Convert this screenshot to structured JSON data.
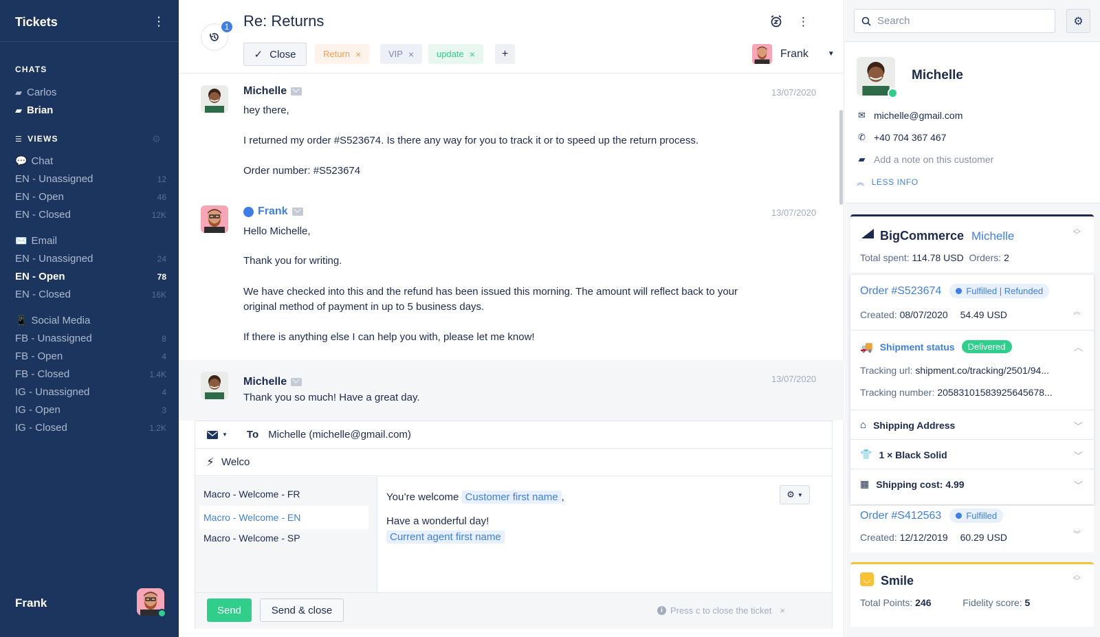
{
  "sidebar": {
    "title": "Tickets",
    "chats_title": "CHATS",
    "chats": [
      {
        "label": "Carlos",
        "active": false
      },
      {
        "label": "Brian",
        "active": true
      }
    ],
    "views_title": "VIEWS",
    "categories": [
      {
        "emoji": "💬",
        "label": "Chat",
        "views": [
          {
            "label": "EN - Unassigned",
            "count": "12"
          },
          {
            "label": "EN - Open",
            "count": "46"
          },
          {
            "label": "EN - Closed",
            "count": "12K"
          }
        ]
      },
      {
        "emoji": "✉️",
        "label": "Email",
        "views": [
          {
            "label": "EN - Unassigned",
            "count": "24"
          },
          {
            "label": "EN - Open",
            "count": "78"
          },
          {
            "label": "EN - Closed",
            "count": "16K"
          }
        ]
      },
      {
        "emoji": "📱",
        "label": "Social Media",
        "views": [
          {
            "label": "FB - Unassigned",
            "count": "8"
          },
          {
            "label": "FB - Open",
            "count": "4"
          },
          {
            "label": "FB - Closed",
            "count": "1.4K"
          },
          {
            "label": "IG - Unassigned",
            "count": "4"
          },
          {
            "label": "IG - Open",
            "count": "3"
          },
          {
            "label": "IG - Closed",
            "count": "1.2K"
          }
        ]
      }
    ],
    "user": "Frank"
  },
  "ticket": {
    "history_count": "1",
    "title": "Re: Returns",
    "close_label": "Close",
    "tags": [
      "Return",
      "VIP",
      "update"
    ],
    "add_tag": "+",
    "assignee": "Frank"
  },
  "messages": [
    {
      "author": "Michelle",
      "date": "13/07/2020",
      "lines": [
        "hey there,",
        "I returned my order #S523674. Is there any way for you to track it or to speed up the return process.",
        "Order number: #S523674"
      ]
    },
    {
      "author": "Frank",
      "date": "13/07/2020",
      "lines": [
        "Hello Michelle,",
        "Thank you for writing.",
        "We have checked into this and the refund has been issued this morning. The amount will reflect back to your",
        "original method of payment in up to 5 business days.",
        "If there is anything else I can help you with, please let me know!"
      ]
    },
    {
      "author": "Michelle",
      "date": "13/07/2020",
      "lines": [
        "Thank you so much! Have a great day."
      ]
    }
  ],
  "composer": {
    "to_label": "To",
    "to_value": "Michelle (michelle@gmail.com)",
    "macro_query": "Welco",
    "macros": [
      "Macro - Welcome - FR",
      "Macro - Welcome - EN",
      "Macro - Welcome - SP"
    ],
    "preview": {
      "line1_text": "You’re welcome",
      "line1_var": "Customer first name",
      "line1_suffix": ",",
      "line2_text": "Have a wonderful day!",
      "line3_var": "Current agent first name"
    },
    "send_label": "Send",
    "send_close_label": "Send & close",
    "hint": "Press c to close the ticket"
  },
  "customer_panel": {
    "search_placeholder": "Search",
    "name": "Michelle",
    "email": "michelle@gmail.com",
    "phone": "+40 704 367 467",
    "note_placeholder": "Add a note on this customer",
    "less_info": "LESS INFO",
    "bigcommerce": {
      "brand": "BigCommerce",
      "customer": "Michelle",
      "total_spent_label": "Total spent:",
      "total_spent": "114.78 USD",
      "orders_label": "Orders:",
      "orders": "2"
    },
    "order1": {
      "number": "Order #S523674",
      "status": "Fulfilled | Refunded",
      "created_label": "Created:",
      "created": "08/07/2020",
      "amount": "54.49 USD",
      "shipment_label": "Shipment status",
      "shipment_status": "Delivered",
      "tracking_url_label": "Tracking url:",
      "tracking_url": "shipment.co/tracking/2501/94...",
      "tracking_number_label": "Tracking number:",
      "tracking_number": "20583101583925645678...",
      "shipping_address": "Shipping Address",
      "item": "1 × Black Solid",
      "shipping_cost": "Shipping cost: 4.99"
    },
    "order2": {
      "number": "Order #S412563",
      "status": "Fulfilled",
      "created_label": "Created:",
      "created": "12/12/2019",
      "amount": "60.29 USD"
    },
    "smile": {
      "brand": "Smile",
      "points_label": "Total Points:",
      "points": "246",
      "fidelity_label": "Fidelity score:",
      "fidelity": "5"
    }
  }
}
